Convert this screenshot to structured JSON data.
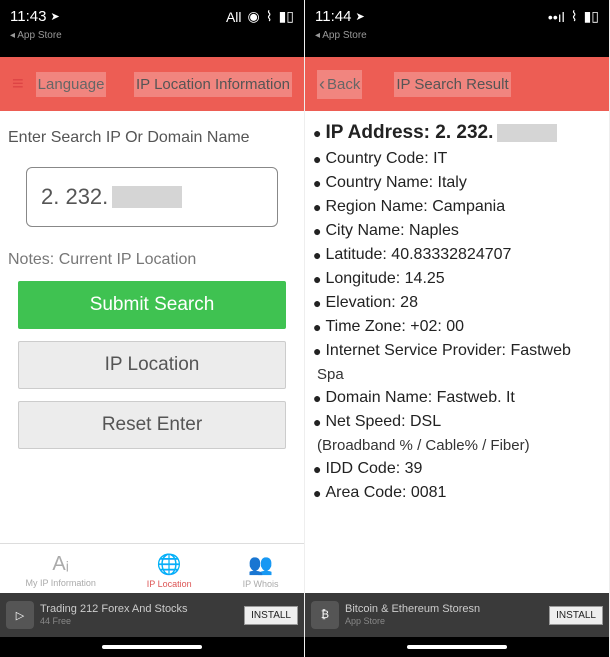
{
  "left": {
    "status": {
      "time": "11:43",
      "back_to": "App Store",
      "right": "All"
    },
    "header": {
      "language": "Language",
      "title": "IP Location Information"
    },
    "search_label": "Enter Search IP Or Domain Name",
    "ip_value": "2. 232.",
    "notes": "Notes: Current IP Location",
    "buttons": {
      "submit": "Submit Search",
      "location": "IP Location",
      "reset": "Reset Enter"
    },
    "tabs": {
      "info": "My IP Information",
      "location": "IP Location",
      "whois": "IP Whois"
    },
    "ad": {
      "icon": "▷",
      "title": "Trading 212 Forex And Stocks",
      "subtitle": "44 Free",
      "install": "INSTALL"
    }
  },
  "right": {
    "status": {
      "time": "11:44",
      "back_to": "App Store"
    },
    "header": {
      "back": "Back",
      "title": "IP Search Result"
    },
    "results": {
      "ip_label": "IP Address: 2. 232.",
      "country_code": "Country Code: IT",
      "country_name": "Country Name: Italy",
      "region": "Region Name: Campania",
      "city": "City Name: Naples",
      "lat": "Latitude: 40.83332824707",
      "lon": "Longitude: 14.25",
      "elevation": "Elevation: 28",
      "timezone": "Time Zone: +02: 00",
      "isp": "Internet Service Provider: Fastweb",
      "isp_sub": "Spa",
      "domain": "Domain Name: Fastweb. It",
      "netspeed": "Net Speed: DSL",
      "netspeed_sub": "(Broadband % / Cable% / Fiber)",
      "idd": "IDD Code: 39",
      "area": "Area Code: 0081"
    },
    "ad": {
      "icon": "₿",
      "title": "Bitcoin & Ethereum Storesn",
      "subtitle": "App Store",
      "install": "INSTALL"
    }
  }
}
